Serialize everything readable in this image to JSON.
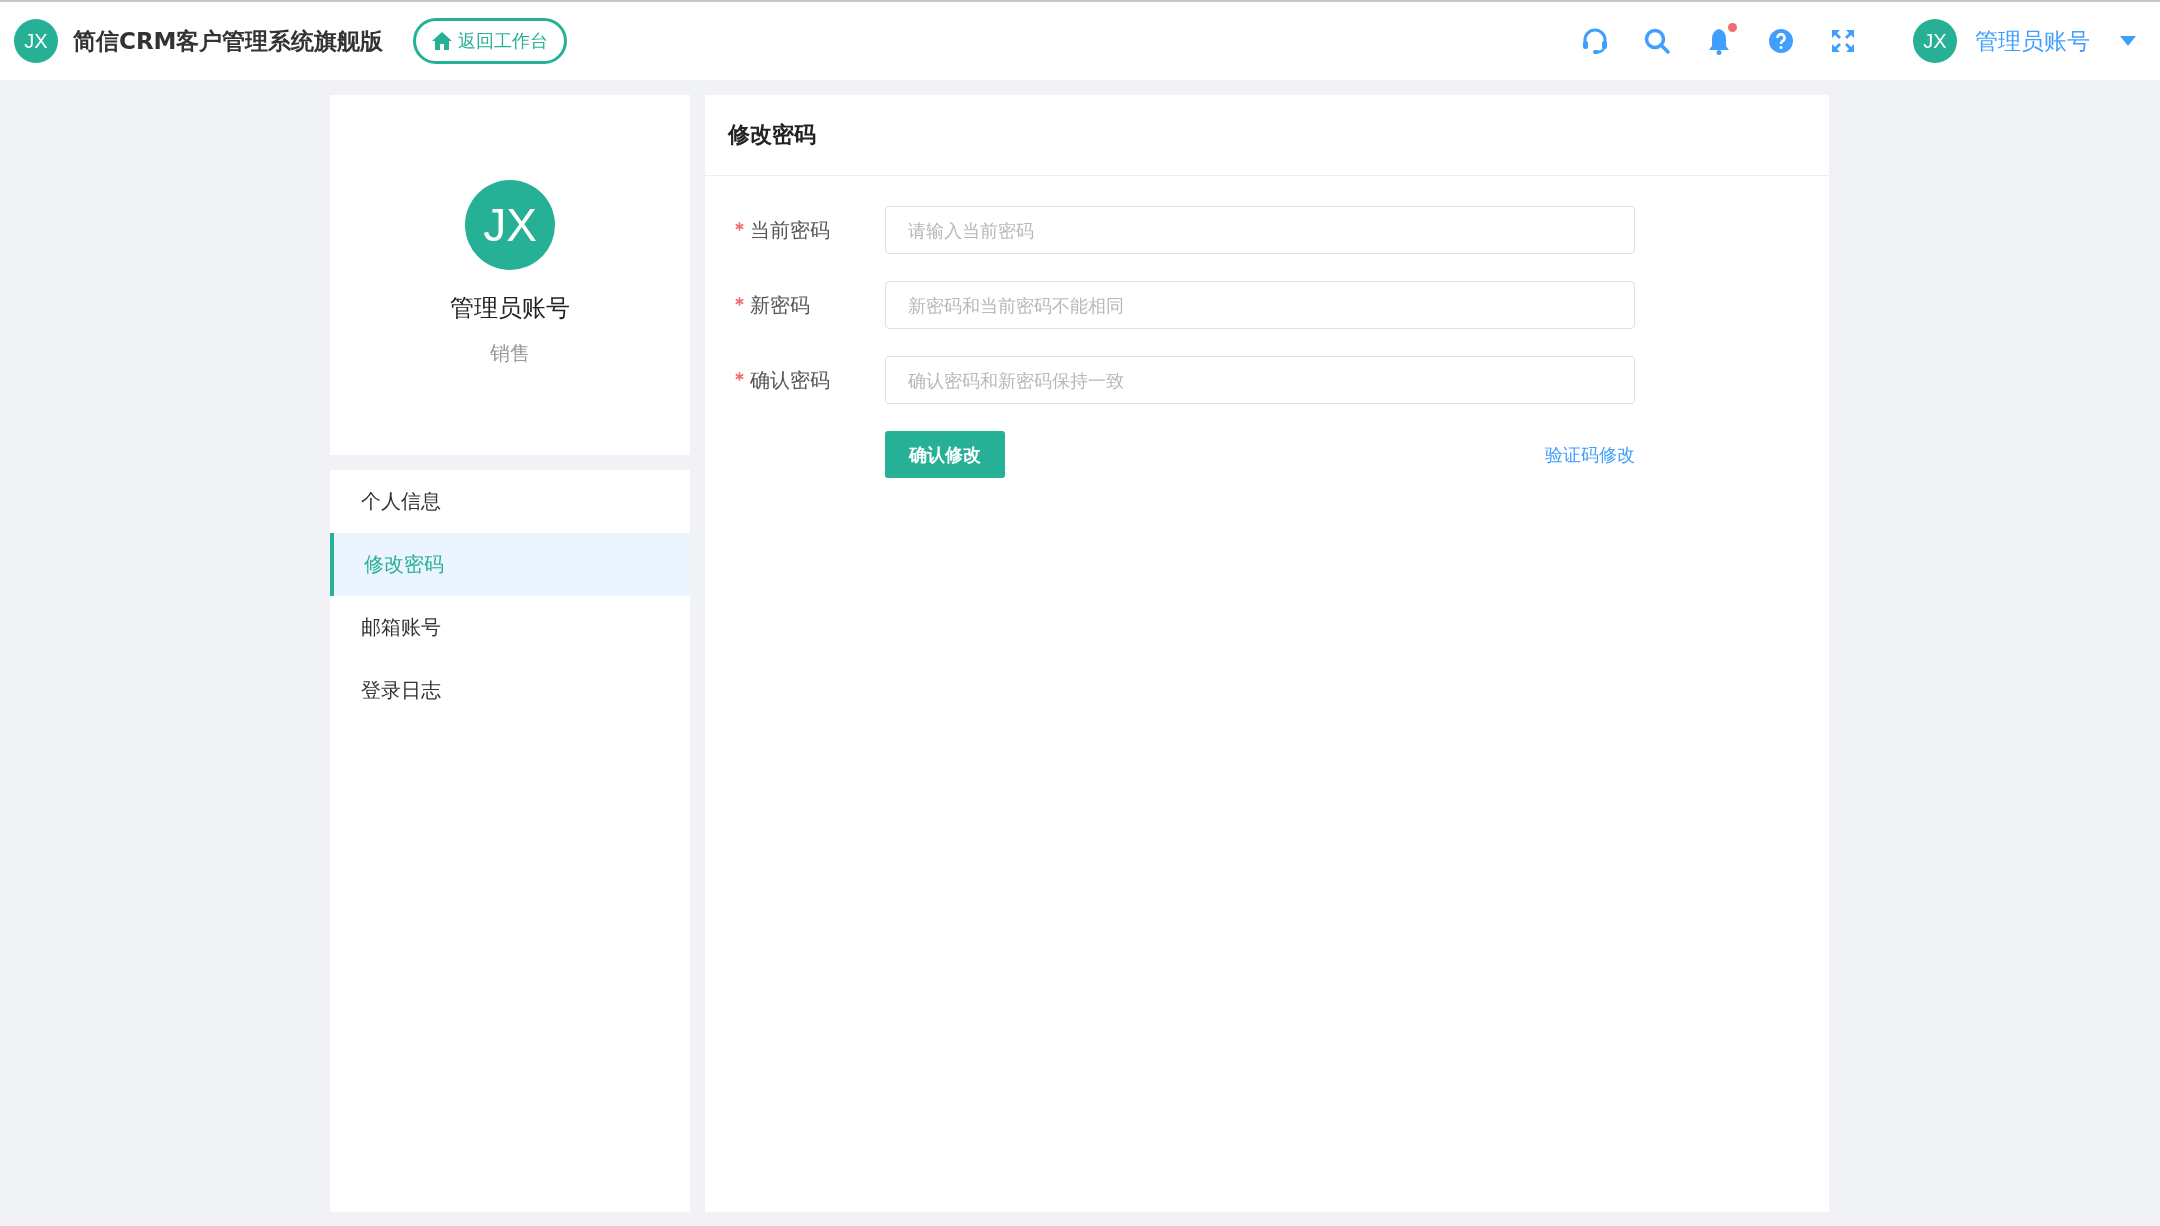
{
  "header": {
    "logo_text": "JX",
    "title": "简信CRM客户管理系统旗舰版",
    "back_button": "返回工作台",
    "notification_badge": true,
    "user": {
      "avatar_text": "JX",
      "name": "管理员账号"
    }
  },
  "profile": {
    "avatar_text": "JX",
    "name": "管理员账号",
    "role": "销售"
  },
  "menu": [
    {
      "label": "个人信息",
      "selected": false
    },
    {
      "label": "修改密码",
      "selected": true
    },
    {
      "label": "邮箱账号",
      "selected": false
    },
    {
      "label": "登录日志",
      "selected": false
    }
  ],
  "form": {
    "title": "修改密码",
    "fields": [
      {
        "label": "当前密码",
        "required": true,
        "placeholder": "请输入当前密码"
      },
      {
        "label": "新密码",
        "required": true,
        "placeholder": "新密码和当前密码不能相同"
      },
      {
        "label": "确认密码",
        "required": true,
        "placeholder": "确认密码和新密码保持一致"
      }
    ],
    "submit_button": "确认修改",
    "alt_link": "验证码修改"
  }
}
